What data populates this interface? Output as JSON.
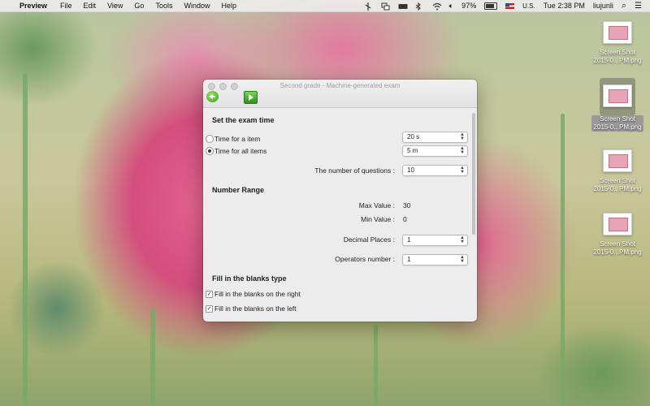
{
  "menubar": {
    "apple_glyph": "",
    "app_name": "Preview",
    "menus": [
      "File",
      "Edit",
      "View",
      "Go",
      "Tools",
      "Window",
      "Help"
    ],
    "battery_percent": "97%",
    "input_source": "U.S.",
    "clock": "Tue 2:38 PM",
    "user": "liujunli",
    "search_glyph": "⌕",
    "list_glyph": "☰"
  },
  "desktop": {
    "items": [
      {
        "label_line1": "Screen Shot",
        "label_line2": "2015-0...PM.png"
      },
      {
        "label_line1": "Screen Shot",
        "label_line2": "2015-0...PM.png"
      },
      {
        "label_line1": "Screen Shot",
        "label_line2": "2015-0...PM.png"
      },
      {
        "label_line1": "Screen Shot",
        "label_line2": "2015-0...PM.png"
      }
    ]
  },
  "window": {
    "title": "Second grade - Machine-generated exam",
    "exam_time": {
      "heading": "Set the exam time",
      "per_item_label": "Time for a item",
      "per_item_value": "20 s",
      "all_items_label": "Time for all items",
      "all_items_value": "5 m",
      "selected": "all_items"
    },
    "questions": {
      "label": "The number of questions :",
      "value": "10"
    },
    "number_range": {
      "heading": "Number Range",
      "max_label": "Max Value :",
      "max_value": "30",
      "min_label": "Min Value :",
      "min_value": "0",
      "decimal_label": "Decimal Places :",
      "decimal_value": "1",
      "operators_label": "Operators number :",
      "operators_value": "1"
    },
    "blanks": {
      "heading": "Fill in the blanks type",
      "right_label": "Fill in the blanks on the right",
      "right_checked": true,
      "left_label": "Fill in the blanks on the left",
      "left_checked": true,
      "check_glyph": "✓"
    },
    "chevron_up": "▲",
    "chevron_down": "▼"
  }
}
